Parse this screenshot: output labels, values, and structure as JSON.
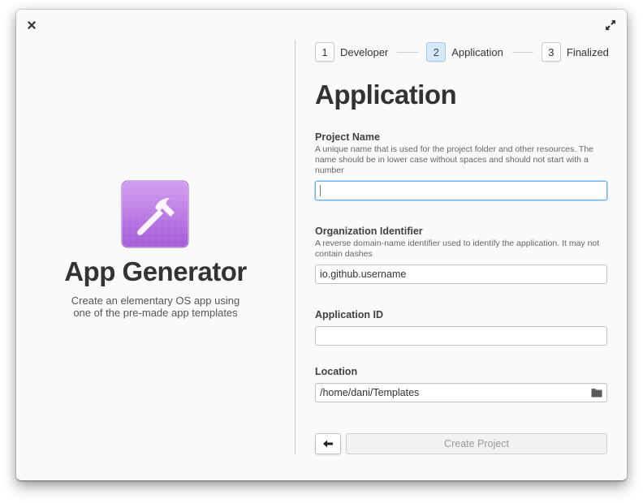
{
  "window": {
    "close_icon": "close-icon",
    "maximize_icon": "maximize-icon"
  },
  "sidebar": {
    "app_icon": "hammer-icon",
    "title": "App Generator",
    "subtitle_line1": "Create an elementary OS app using",
    "subtitle_line2": "one of the pre-made app templates",
    "icon_colors": {
      "top": "#d39ff0",
      "bottom": "#a35ad8"
    }
  },
  "stepper": {
    "steps": [
      {
        "number": "1",
        "label": "Developer",
        "active": false
      },
      {
        "number": "2",
        "label": "Application",
        "active": true
      },
      {
        "number": "3",
        "label": "Finalized",
        "active": false
      }
    ]
  },
  "form": {
    "title": "Application",
    "project_name": {
      "label": "Project Name",
      "description": "A unique name that is used for the project folder and other resources. The name should be in lower case without spaces and should not start with a number",
      "value": ""
    },
    "organization_identifier": {
      "label": "Organization Identifier",
      "description": "A reverse domain-name identifier used to identify the application. It may not contain dashes",
      "value": "io.github.username"
    },
    "application_id": {
      "label": "Application ID",
      "value": ""
    },
    "location": {
      "label": "Location",
      "value": "/home/dani/Templates",
      "icon": "folder-icon"
    }
  },
  "actions": {
    "back_icon": "arrow-left-icon",
    "create_label": "Create Project"
  },
  "colors": {
    "accent_focus": "#6fb1ee",
    "active_step_bg": "#d6e9fb",
    "text": "#333333"
  }
}
